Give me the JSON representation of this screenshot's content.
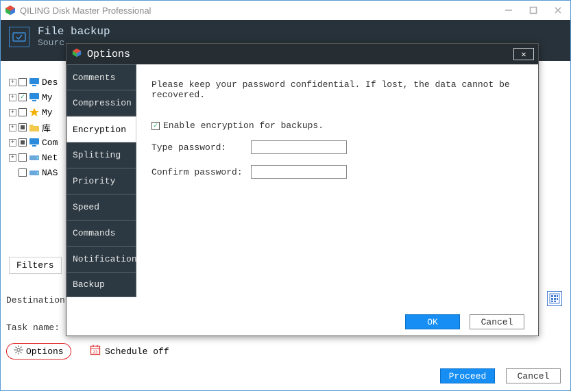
{
  "window": {
    "title": "QILING Disk Master Professional"
  },
  "header": {
    "title": "File backup",
    "subtitle": "Sourc"
  },
  "tree": [
    {
      "label": "Des",
      "check": "unchecked",
      "iconColor": "#2a8bdc",
      "shape": "monitor"
    },
    {
      "label": "My",
      "check": "checked",
      "iconColor": "#2a8bdc",
      "shape": "monitor"
    },
    {
      "label": "My",
      "check": "unchecked",
      "iconColor": "#f2b100",
      "shape": "star"
    },
    {
      "label": "库",
      "check": "partial",
      "iconColor": "#f2c94c",
      "shape": "folder"
    },
    {
      "label": "Com",
      "check": "partial",
      "iconColor": "#2a8bdc",
      "shape": "monitor"
    },
    {
      "label": "Net",
      "check": "unchecked",
      "iconColor": "#6aa8dc",
      "shape": "drive"
    },
    {
      "label": "NAS",
      "check": "unchecked",
      "iconColor": "#6aa8dc",
      "shape": "drive",
      "noPlus": true
    }
  ],
  "filters": {
    "label": "Filters"
  },
  "labels": {
    "destination": "Destination:",
    "task": "Task name:"
  },
  "footer": {
    "options": "Options",
    "schedule": "Schedule off",
    "proceed": "Proceed",
    "cancel": "Cancel"
  },
  "dialog": {
    "title": "Options",
    "tabs": [
      "Comments",
      "Compression",
      "Encryption",
      "Splitting",
      "Priority",
      "Speed",
      "Commands",
      "Notification",
      "Backup"
    ],
    "activeTab": 2,
    "encryption": {
      "warning": "Please keep your password confidential. If lost, the data cannot be recovered.",
      "enableLabel": "Enable encryption for backups.",
      "enableChecked": true,
      "pwdLabel": "Type password:",
      "confirmLabel": "Confirm password:",
      "pwdValue": "",
      "confirmValue": ""
    },
    "ok": "OK",
    "cancel": "Cancel"
  }
}
